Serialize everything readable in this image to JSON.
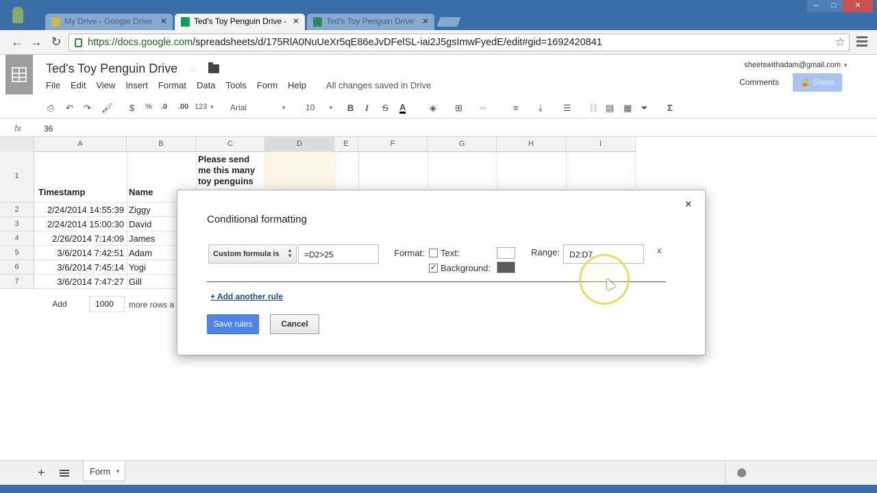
{
  "browser": {
    "tabs": [
      {
        "label": "My Drive - Google Drive",
        "state": "inactive"
      },
      {
        "label": "Ted's Toy Penguin Drive -",
        "state": "active"
      },
      {
        "label": "Ted's Toy Penguin Drive",
        "state": "inactive"
      }
    ],
    "url_host": "https://docs.google.com",
    "url_path": "/spreadsheets/d/175RlA0NuUeXr5qE86eJvDFelSL-iai2J5gsImwFyedE/edit#gid=1692420841"
  },
  "doc": {
    "title": "Ted's Toy Penguin Drive",
    "account": "sheetswithadam@gmail.com",
    "comments_label": "Comments",
    "share_label": "Share",
    "save_status": "All changes saved in Drive",
    "menu": [
      "File",
      "Edit",
      "View",
      "Insert",
      "Format",
      "Data",
      "Tools",
      "Form",
      "Help"
    ]
  },
  "toolbar": {
    "currency": "$",
    "percent": "%",
    "decrease_decimals": ".0",
    "increase_decimals": ".00",
    "more_formats": "123",
    "font": "Arial",
    "font_size": "10",
    "bold": "B",
    "italic": "I",
    "strike": "S",
    "text_color": "A",
    "functions": "Σ"
  },
  "formula_bar": {
    "label": "fx",
    "value": "36"
  },
  "grid": {
    "columns": [
      "A",
      "B",
      "C",
      "D",
      "E",
      "F",
      "G",
      "H",
      "I"
    ],
    "rows": [
      "1",
      "2",
      "3",
      "4",
      "5",
      "6",
      "7"
    ],
    "headers": {
      "a": "Timestamp",
      "b": "Name",
      "c": "Please send me this many toy penguins"
    },
    "data": [
      {
        "timestamp": "2/24/2014 14:55:39",
        "name": "Ziggy"
      },
      {
        "timestamp": "2/24/2014 15:00:30",
        "name": "David"
      },
      {
        "timestamp": "2/26/2014 7:14:09",
        "name": "James"
      },
      {
        "timestamp": "3/6/2014 7:42:51",
        "name": "Adam"
      },
      {
        "timestamp": "3/6/2014 7:45:14",
        "name": "Yogi"
      },
      {
        "timestamp": "3/6/2014 7:47:27",
        "name": "Gill"
      }
    ],
    "add_label": "Add",
    "add_rows_value": "1000",
    "more_rows_label": "more rows a"
  },
  "bottom": {
    "plus": "+",
    "sheet_tab": "Form"
  },
  "dialog": {
    "title": "Conditional formatting",
    "condition": "Custom formula is",
    "formula": "=D2>25",
    "format_label": "Format:",
    "text_label": "Text:",
    "text_checked": false,
    "background_label": "Background:",
    "background_checked": true,
    "background_color": "#5a5a5a",
    "range_label": "Range:",
    "range": "D2:D7",
    "remove_rule": "x",
    "add_rule": "+ Add another rule",
    "save": "Save rules",
    "cancel": "Cancel",
    "close": "×"
  },
  "colors": {
    "chrome": "#3c6ea8",
    "primary_button": "#4d86e8",
    "sheets_green": "#0f9d58"
  }
}
